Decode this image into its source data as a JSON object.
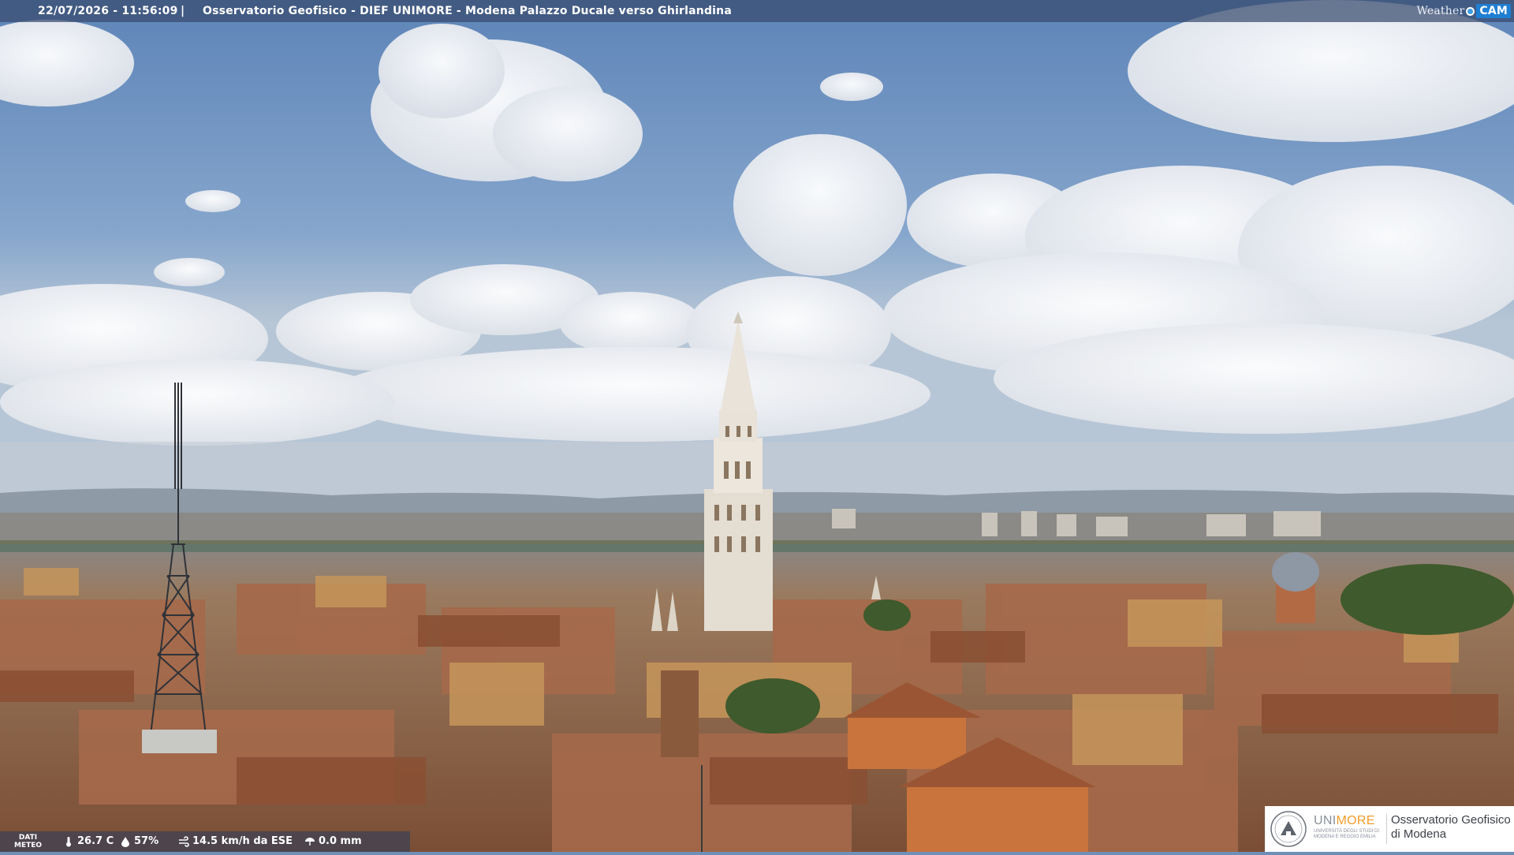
{
  "header": {
    "datetime": "22/07/2026 - 11:56:09",
    "separator": "|",
    "title": "Osservatorio Geofisico - DIEF UNIMORE - Modena Palazzo Ducale verso Ghirlandina"
  },
  "brand": {
    "weather": "Weather",
    "cam": "CAM"
  },
  "meteo": {
    "label_line1": "DATI",
    "label_line2": "METEO",
    "temperature": "26.7 C",
    "humidity": "57%",
    "wind": "14.5 km/h da ESE",
    "rain": "0.0 mm",
    "icons": [
      "thermometer-icon",
      "humidity-icon",
      "wind-icon",
      "rain-gauge-icon"
    ]
  },
  "logo": {
    "uni": "UNI",
    "more": "MORE",
    "subtitle": "UNIVERSITÀ DEGLI STUDI DI MODENA E REGGIO EMILIA",
    "observatory_line1": "Osservatorio Geofisico",
    "observatory_line2": "di Modena"
  },
  "colors": {
    "sky": "#6f8fb7",
    "roofs": "#9a6a4a",
    "tower": "#e4ddd2",
    "accent": "#f29d2a",
    "brand_blue": "#1f7fd3"
  }
}
